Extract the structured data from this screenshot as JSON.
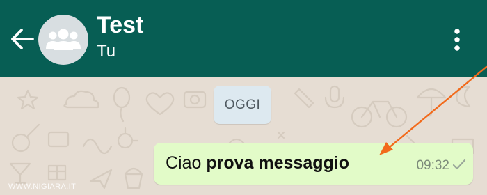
{
  "header": {
    "title": "Test",
    "subtitle": "Tu",
    "back_icon": "arrow-left-icon",
    "avatar_icon": "group-icon",
    "menu_icon": "more-vert-icon"
  },
  "chat": {
    "date_label": "OGGI",
    "message": {
      "text_regular": "Ciao ",
      "text_bold": "prova messaggio",
      "time": "09:32",
      "status_icon": "check-icon"
    }
  },
  "watermark": "WWW.NIGIARA.IT",
  "colors": {
    "header_bg": "#075e54",
    "chat_bg": "#e6ddd3",
    "bubble_bg": "#e2fbc8",
    "date_chip_bg": "#dde9f0",
    "annotation_arrow": "#f26a1b"
  }
}
